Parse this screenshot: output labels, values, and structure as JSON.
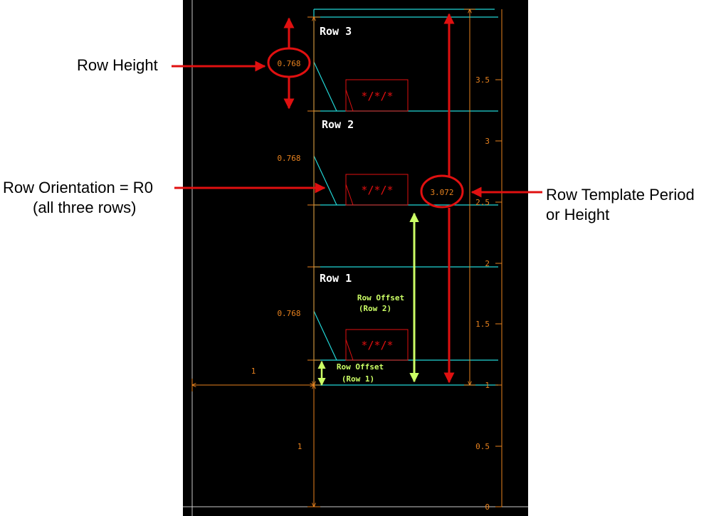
{
  "callouts": {
    "row_height": "Row Height",
    "row_orientation_1": "Row Orientation = R0",
    "row_orientation_2": "(all three rows)",
    "template_1": "Row Template Period",
    "template_2": "or Height"
  },
  "rows": [
    {
      "title": "Row 3",
      "height": "0.768",
      "marker": "*/*/*"
    },
    {
      "title": "Row 2",
      "height": "0.768",
      "marker": "*/*/*"
    },
    {
      "title": "Row 1",
      "height": "0.768",
      "marker": "*/*/*"
    }
  ],
  "offsets": {
    "row2_line1": "Row Offset",
    "row2_line2": "(Row 2)",
    "row1_line1": "Row Offset",
    "row1_line2": "(Row 1)"
  },
  "template_period": "3.072",
  "dims": {
    "horizontal": "1",
    "vertical": "1"
  },
  "axis_ticks": [
    "3.5",
    "3",
    "2.5",
    "2",
    "1.5",
    "1",
    "0.5",
    "0"
  ],
  "colors": {
    "background": "#000000",
    "row_lines": "#22d6d6",
    "dimension": "#e8821e",
    "annotation_red": "#e01010",
    "offset_green": "#ccff66",
    "frame": "#c8c8c8"
  }
}
